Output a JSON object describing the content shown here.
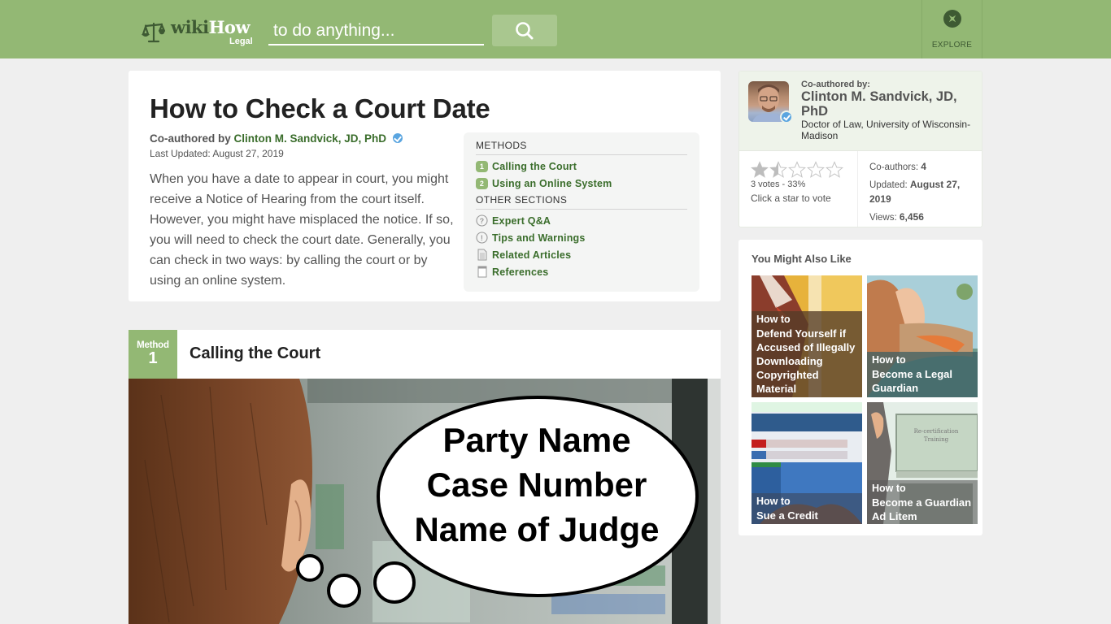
{
  "header": {
    "logo_main": "wiki",
    "logo_accent": "How",
    "logo_sub": "Legal",
    "search_placeholder": "to do anything...",
    "search_icon": "search-icon",
    "explore_label": "EXPLORE",
    "explore_icon": "compass-icon"
  },
  "colors": {
    "brand_green": "#93b874",
    "dark_green": "#3e5a33",
    "link_green": "#3a6d2b",
    "verified_blue": "#5aa5e0"
  },
  "article": {
    "title": "How to Check a Court Date",
    "coauthored_prefix": "Co-authored by",
    "coauthor_name": "Clinton M. Sandvick, JD, PhD",
    "last_updated": "Last Updated: August 27, 2019",
    "intro": "When you have a date to appear in court, you might receive a Notice of Hearing from the court itself. However, you might have misplaced the notice. If so, you will need to check the court date. Generally, you can check in two ways: by calling the court or by using an online system."
  },
  "toc": {
    "methods_heading": "METHODS",
    "methods": [
      {
        "num": "1",
        "label": "Calling the Court"
      },
      {
        "num": "2",
        "label": "Using an Online System"
      }
    ],
    "other_heading": "OTHER SECTIONS",
    "sections": [
      {
        "icon": "question-circle-icon",
        "label": "Expert Q&A"
      },
      {
        "icon": "exclamation-circle-icon",
        "label": "Tips and Warnings"
      },
      {
        "icon": "document-icon",
        "label": "Related Articles"
      },
      {
        "icon": "book-icon",
        "label": "References"
      }
    ]
  },
  "method": {
    "badge_label": "Method",
    "badge_number": "1",
    "title": "Calling the Court",
    "image_text": [
      "Party Name",
      "Case Number",
      "Name of Judge"
    ]
  },
  "author_card": {
    "label": "Co-authored by:",
    "name": "Clinton M. Sandvick, JD, PhD",
    "credential": "Doctor of Law, University of Wisconsin-Madison",
    "rating_stars": 1.5,
    "rating_max": 5,
    "votes": "3 votes - 33%",
    "vote_cta": "Click a star to vote",
    "coauthors_label": "Co-authors:",
    "coauthors_value": "4",
    "updated_label": "Updated:",
    "updated_value": "August 27, 2019",
    "views_label": "Views:",
    "views_value": "6,456"
  },
  "related": {
    "title": "You Might Also Like",
    "items": [
      {
        "prefix": "How to",
        "title": "Defend Yourself if Accused of Illegally Downloading Copyrighted Material"
      },
      {
        "prefix": "How to",
        "title": "Become a Legal Guardian"
      },
      {
        "prefix": "How to",
        "title": "Sue a Credit Bureau"
      },
      {
        "prefix": "How to",
        "title": "Become a Guardian Ad Litem"
      }
    ]
  }
}
